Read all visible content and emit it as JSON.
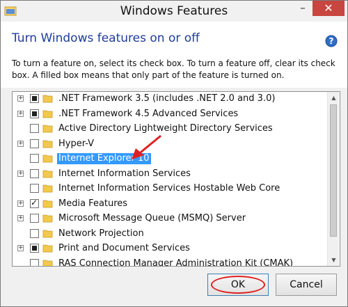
{
  "window": {
    "title": "Windows Features",
    "minimize_glyph": "–",
    "close_glyph": "✕"
  },
  "header": {
    "title": "Turn Windows features on or off",
    "instructions": "To turn a feature on, select its check box. To turn a feature off, clear its check box. A filled box means that only part of the feature is turned on."
  },
  "features": [
    {
      "label": ".NET Framework 3.5 (includes .NET 2.0 and 3.0)",
      "expandable": true,
      "state": "partial",
      "selected": false
    },
    {
      "label": ".NET Framework 4.5 Advanced Services",
      "expandable": true,
      "state": "partial",
      "selected": false
    },
    {
      "label": "Active Directory Lightweight Directory Services",
      "expandable": false,
      "state": "unchecked",
      "selected": false
    },
    {
      "label": "Hyper-V",
      "expandable": true,
      "state": "unchecked",
      "selected": false
    },
    {
      "label": "Internet Explorer 10",
      "expandable": false,
      "state": "unchecked",
      "selected": true
    },
    {
      "label": "Internet Information Services",
      "expandable": true,
      "state": "unchecked",
      "selected": false
    },
    {
      "label": "Internet Information Services Hostable Web Core",
      "expandable": false,
      "state": "unchecked",
      "selected": false
    },
    {
      "label": "Media Features",
      "expandable": true,
      "state": "checked",
      "selected": false
    },
    {
      "label": "Microsoft Message Queue (MSMQ) Server",
      "expandable": true,
      "state": "unchecked",
      "selected": false
    },
    {
      "label": "Network Projection",
      "expandable": false,
      "state": "unchecked",
      "selected": false
    },
    {
      "label": "Print and Document Services",
      "expandable": true,
      "state": "partial",
      "selected": false
    },
    {
      "label": "RAS Connection Manager Administration Kit (CMAK)",
      "expandable": false,
      "state": "unchecked",
      "selected": false
    }
  ],
  "buttons": {
    "ok": "OK",
    "cancel": "Cancel"
  },
  "colors": {
    "title_blue": "#1f3c99",
    "selection": "#3399ff",
    "annotation_red": "#e02020",
    "close_red": "#c7463f"
  }
}
